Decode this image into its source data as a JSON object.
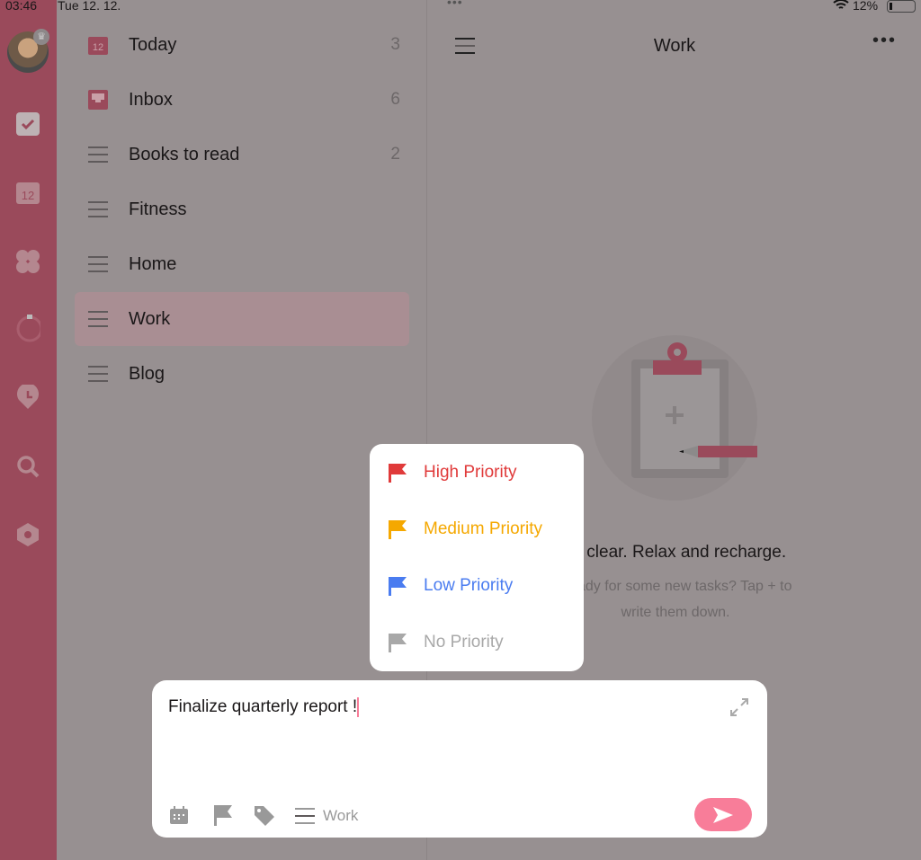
{
  "status": {
    "time": "03:46",
    "date": "Tue 12. 12.",
    "battery": "12%"
  },
  "rail": {
    "icons": [
      "check-icon",
      "calendar-icon",
      "grid-icon",
      "pomodoro-icon",
      "clock-pin-icon",
      "search-icon",
      "settings-icon"
    ],
    "calendar_day": "12"
  },
  "lists": [
    {
      "label": "Today",
      "count": "3",
      "icon": "calendar-icon"
    },
    {
      "label": "Inbox",
      "count": "6",
      "icon": "inbox-icon"
    },
    {
      "label": "Books to read",
      "count": "2",
      "icon": "list-icon"
    },
    {
      "label": "Fitness",
      "count": "",
      "icon": "list-icon"
    },
    {
      "label": "Home",
      "count": "",
      "icon": "list-icon"
    },
    {
      "label": "Work",
      "count": "",
      "icon": "list-icon",
      "selected": true
    },
    {
      "label": "Blog",
      "count": "",
      "icon": "list-icon"
    }
  ],
  "main": {
    "title": "Work",
    "empty_title": "All clear. Relax and recharge.",
    "empty_sub": "Ready for some new tasks? Tap + to write them down."
  },
  "priority_menu": [
    {
      "label": "High Priority",
      "color": "#e03a3a"
    },
    {
      "label": "Medium Priority",
      "color": "#f5a800"
    },
    {
      "label": "Low Priority",
      "color": "#4a7cf0"
    },
    {
      "label": "No Priority",
      "color": "#a8a8a8"
    }
  ],
  "composer": {
    "text": "Finalize quarterly report !",
    "list": "Work",
    "accent": "#f87d99"
  }
}
